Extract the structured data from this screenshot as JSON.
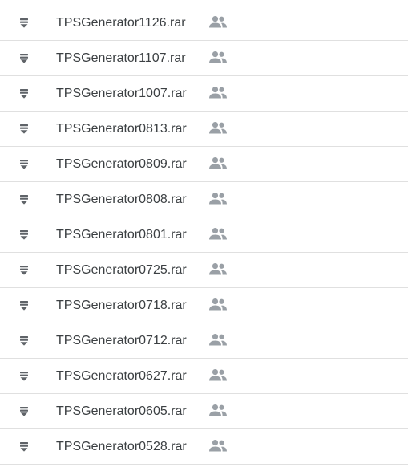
{
  "colors": {
    "text": "#3c4043",
    "icon": "#5f6368",
    "shared_icon": "#9aa0a6",
    "divider": "#e0e0e0"
  },
  "files": [
    {
      "name": "TPSGenerator1126.rar",
      "type_icon": "archive-icon",
      "shared": true
    },
    {
      "name": "TPSGenerator1107.rar",
      "type_icon": "archive-icon",
      "shared": true
    },
    {
      "name": "TPSGenerator1007.rar",
      "type_icon": "archive-icon",
      "shared": true
    },
    {
      "name": "TPSGenerator0813.rar",
      "type_icon": "archive-icon",
      "shared": true
    },
    {
      "name": "TPSGenerator0809.rar",
      "type_icon": "archive-icon",
      "shared": true
    },
    {
      "name": "TPSGenerator0808.rar",
      "type_icon": "archive-icon",
      "shared": true
    },
    {
      "name": "TPSGenerator0801.rar",
      "type_icon": "archive-icon",
      "shared": true
    },
    {
      "name": "TPSGenerator0725.rar",
      "type_icon": "archive-icon",
      "shared": true
    },
    {
      "name": "TPSGenerator0718.rar",
      "type_icon": "archive-icon",
      "shared": true
    },
    {
      "name": "TPSGenerator0712.rar",
      "type_icon": "archive-icon",
      "shared": true
    },
    {
      "name": "TPSGenerator0627.rar",
      "type_icon": "archive-icon",
      "shared": true
    },
    {
      "name": "TPSGenerator0605.rar",
      "type_icon": "archive-icon",
      "shared": true
    },
    {
      "name": "TPSGenerator0528.rar",
      "type_icon": "archive-icon",
      "shared": true
    }
  ]
}
